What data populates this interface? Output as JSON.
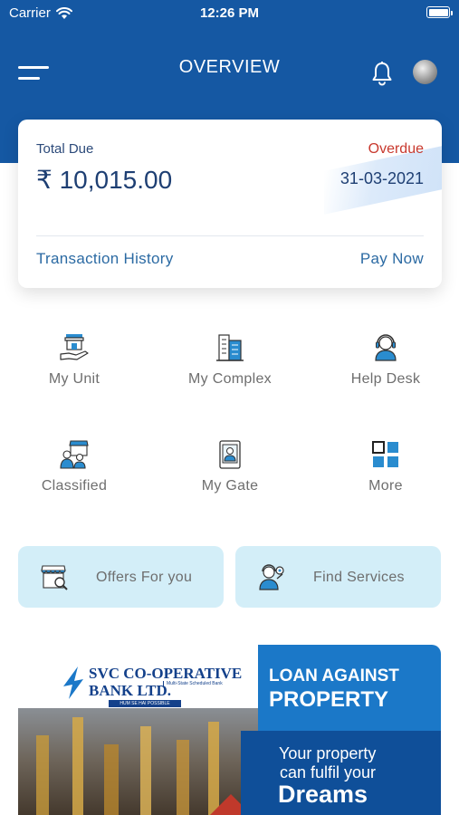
{
  "status_bar": {
    "carrier": "Carrier",
    "time": "12:26 PM"
  },
  "header": {
    "title": "OVERVIEW"
  },
  "due_card": {
    "total_due_label": "Total Due",
    "amount": "₹ 10,015.00",
    "overdue_label": "Overdue",
    "due_date": "31-03-2021",
    "transaction_history": "Transaction History",
    "pay_now": "Pay Now"
  },
  "quick_grid": [
    {
      "label": "My Unit",
      "icon": "hand-with-shop-icon"
    },
    {
      "label": "My Complex",
      "icon": "buildings-icon"
    },
    {
      "label": "Help Desk",
      "icon": "headset-agent-icon"
    },
    {
      "label": "Classified",
      "icon": "market-people-icon"
    },
    {
      "label": "My Gate",
      "icon": "gate-id-card-icon"
    },
    {
      "label": "More",
      "icon": "grid-icon"
    }
  ],
  "pills": [
    {
      "label": "Offers For you",
      "icon": "store-search-icon"
    },
    {
      "label": "Find Services",
      "icon": "service-person-icon"
    }
  ],
  "banner": {
    "bank_line1": "SVC CO-OPERATIVE",
    "bank_line2": "BANK LTD.",
    "bank_subtitle": "Multi-State Scheduled Bank",
    "bank_tagline": "HUM SE HAI POSSIBLE",
    "headline_line1": "LOAN AGAINST",
    "headline_line2": "PROPERTY",
    "promo_line1": "Your property",
    "promo_line2": "can fulfil your",
    "promo_line3": "Dreams"
  },
  "colors": {
    "header_blue": "#1558a3",
    "overdue_red": "#c8392e",
    "link_blue": "#2b6aa3",
    "icon_blue": "#2a8ccf",
    "pill_bg": "#d3eef8"
  }
}
